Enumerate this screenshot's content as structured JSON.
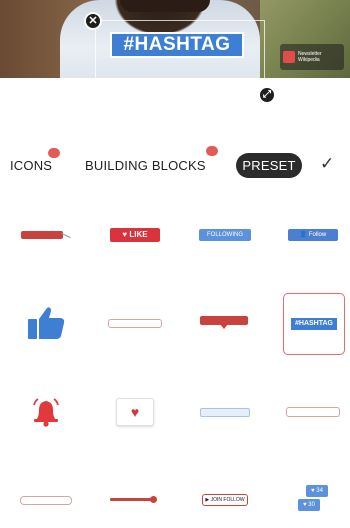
{
  "preview": {
    "sticker_text": "#HASHTAG",
    "close_symbol": "✕",
    "resize_symbol": "⤢",
    "badge_text": "Newsletter Wikipedia"
  },
  "tabs": {
    "icons": "ICONS",
    "building_blocks": "BUILDING BLOCKS",
    "preset": "PRESET",
    "done_symbol": "✓",
    "icons_badge": "",
    "building_badge": ""
  },
  "grid": {
    "like_label": "♥ LIKE",
    "following_label": "FOLLOWING",
    "follow_label": "👤 Follow",
    "hashtag_label": "#HASHTAG",
    "join_follow_label": "▶ JOIN FOLLOW",
    "count_a": "♥ 34",
    "count_b": "♥ 30"
  },
  "colors": {
    "accent_red": "#d9333b",
    "accent_blue": "#3f7fd3",
    "selected_border": "#e96b68",
    "preset_bg": "#2b2b2b"
  },
  "icons": [
    "close-icon",
    "resize-icon",
    "checkmark-icon",
    "thumbs-up-icon",
    "bell-icon",
    "heart-icon"
  ]
}
